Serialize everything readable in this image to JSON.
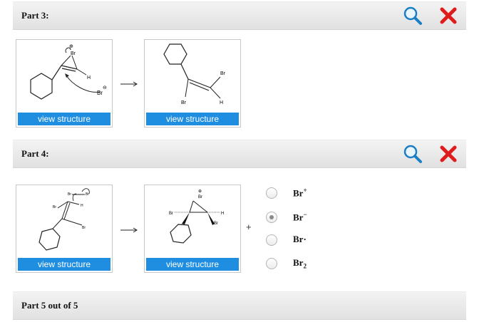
{
  "parts": [
    {
      "title": "Part 3:",
      "structures": [
        {
          "button_label": "view structure",
          "labels": {
            "br_top": "Br",
            "charge_plus": "⊕",
            "h": "H",
            "br_ion": "Br",
            "charge_minus": "⊖"
          }
        },
        {
          "button_label": "view structure",
          "labels": {
            "br1": "Br",
            "br2": "Br",
            "h": "H"
          }
        }
      ]
    },
    {
      "title": "Part 4:",
      "structures": [
        {
          "button_label": "view structure",
          "labels": {
            "br_top_left": "Br",
            "br_top_right": "Br",
            "br_left": "Br",
            "h": "H",
            "br_bottom": "Br"
          }
        },
        {
          "button_label": "view structure",
          "labels": {
            "charge_plus": "⊕",
            "br_top": "Br",
            "br_left": "Br",
            "h": "H",
            "br_under": "Br"
          }
        }
      ],
      "plus_sign": "+",
      "options": [
        {
          "base": "Br",
          "sup": "+",
          "sub": "",
          "selected": false
        },
        {
          "base": "Br",
          "sup": "−",
          "sub": "",
          "selected": true
        },
        {
          "base": "Br·",
          "sup": "",
          "sub": "",
          "selected": false
        },
        {
          "base": "Br",
          "sup": "",
          "sub": "2",
          "selected": false
        }
      ]
    }
  ],
  "footer": {
    "title": "Part 5 out of 5"
  },
  "colors": {
    "button": "#1f8ee0",
    "zoom_icon": "#1b7fc4",
    "close_icon": "#e01b1b"
  },
  "icons": [
    "magnifier-icon",
    "close-x-icon",
    "reaction-arrow-icon",
    "radio-icon"
  ]
}
